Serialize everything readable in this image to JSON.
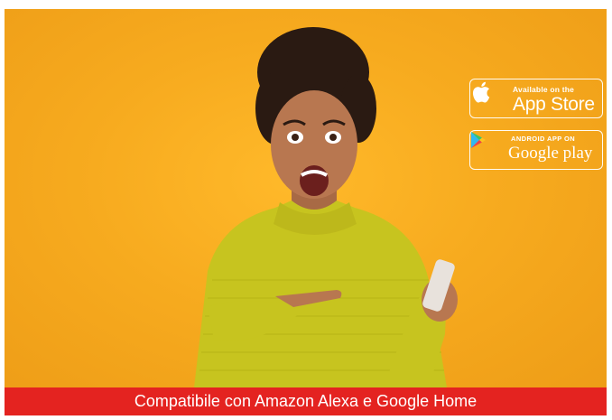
{
  "banner": {
    "background_color": "#f4a722",
    "footer_color": "#e42320",
    "footer_text": "Compatibile con Amazon Alexa e Google Home"
  },
  "badges": {
    "apple": {
      "icon": "apple-logo-icon",
      "small_text": "Available on the",
      "big_text": "App Store"
    },
    "google": {
      "icon": "google-play-icon",
      "small_text": "ANDROID APP ON",
      "big_text": "Google play"
    }
  }
}
